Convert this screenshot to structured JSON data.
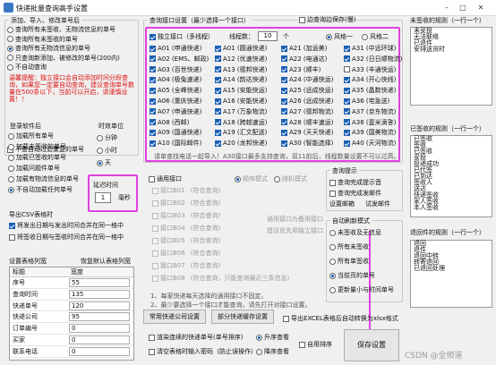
{
  "window": {
    "title": "快递批量查询高手设置"
  },
  "add": {
    "legend": "添加、导入、修改单号后",
    "options": [
      "查询所有未签收、无物流信息的单号",
      "查询所有未签收的单号",
      "查询所有无物流信息的单号",
      "只查询新添加、被修改的单号(200内)",
      "不自动查询"
    ],
    "selected": 2,
    "warning": [
      "温馨提醒：独立接口会自动添加时间分段查询，如果您一定要自动查询，建议查询单号数量在500条以下，当前可以开启，请谨慎设置！！"
    ],
    "no_dup": "不查自动过滤重复的单号"
  },
  "login": {
    "legend": "登录软件后",
    "options": [
      "加载所有单号",
      "加载未签收的单号",
      "加载已签收的单号",
      "加载问题件单号",
      "加载有物流信息的单号",
      "不自动加载任何单号"
    ],
    "selected": 5
  },
  "time_unit": {
    "legend": "时效单位",
    "options": [
      "分钟",
      "小时",
      "天"
    ],
    "selected": 2
  },
  "delay": {
    "label": "延迟时间",
    "value": "1",
    "unit": "毫秒"
  },
  "export": {
    "legend": "导出CSV表格时",
    "options": [
      "将发出日期与发出时间合并在同一格中",
      "将签收日期与签收时间合并在同一格中"
    ],
    "checked": [
      true,
      false
    ]
  },
  "columns": {
    "legend": "设置表格列宽",
    "restore": "恢复默认表格列宽",
    "headers": [
      "标题",
      "宽度"
    ],
    "rows": [
      [
        "序号",
        "55"
      ],
      [
        "查询时间",
        "135"
      ],
      [
        "快递单号",
        "120"
      ],
      [
        "快递公司",
        "95"
      ],
      [
        "订单编号",
        "0"
      ],
      [
        "买家",
        "0"
      ],
      [
        "联系电话",
        "0"
      ]
    ]
  },
  "api": {
    "legend": "查询接口设置（最少选择一个接口）",
    "edge": "边查询边保存(慢)",
    "independent": "独立接口（多线程）",
    "threads_label": "线程数：",
    "threads": "10",
    "threads_unit": "个",
    "styles": [
      "风格一",
      "风格二"
    ],
    "style_selected": 0,
    "items": [
      "A01 (申通快递)",
      "A01 (圆通快递)",
      "A21 (加运美)",
      "A31 (中远环球)",
      "A02 (EMS、邮政)",
      "A12 (优速快递)",
      "A22 (电通达)",
      "A32 (日日顺物流)",
      "A03 (百世快递)",
      "A13 (德邦快递)",
      "A23 (顺丰)",
      "A33 (丰通快运)",
      "A04 (极兔速递)",
      "A14 (韵达快递)",
      "A24 (中通快运)",
      "A34 (开心快线)",
      "A05 (全峰快递)",
      "A15 (安能快运)",
      "A25 (远成快运)",
      "A35 (晶数快递)",
      "A06 (重庆快递)",
      "A16 (安能快递)",
      "A26 (远成快递)",
      "A36 (宅急送)",
      "A07 (申通快递)",
      "A17 (万象物流)",
      "A27 (德邦物流)",
      "A37 (京东物流)",
      "A08 (西邮)",
      "A18 (跨越速运)",
      "A28 (顺丰速运)",
      "A38 (壹米滴答)",
      "A09 (国通快递)",
      "A19 (汇文配送)",
      "A29 (天天快递)",
      "A39 (国美物流)",
      "A10 (国际邮件)",
      "A20 (龙邦快递)",
      "A30 (智能选择)",
      "A40 (天河物流)"
    ],
    "note": "请单查找电话一起导入！A30接口最多支持查询，双11前后，线程数量设置不可以过高。"
  },
  "general": {
    "title": "通用接口",
    "items": [
      "接口B01",
      "接口B02",
      "接口B03",
      "接口B04",
      "接口B05",
      "接口B06",
      "接口B07",
      "接口B08"
    ],
    "placeholder": "(符合查询)",
    "last": "(符合查询，只能查询最近三条信息)",
    "modes": [
      "顺序模式",
      "随机模式"
    ],
    "tip": [
      "通用接口为备用接口",
      "建议优先用独立接口"
    ],
    "bottom": [
      "1、每家快递每天选择的通用接口不固定。",
      "2、最少要选择一个接口才能查询，请先打开对接口设置。"
    ]
  },
  "query_tip": {
    "legend": "查询提示",
    "opts": [
      "查询完成提示音",
      "查询完成发邮件"
    ],
    "email": "设置邮箱",
    "test": "试发邮件"
  },
  "refresh": {
    "legend": "自动刷新模式",
    "options": [
      "未签收及无信息",
      "所有未签收",
      "所有单签收",
      "当前页的单号",
      "更新量小与时间单号"
    ],
    "selected": 3
  },
  "common_btn": "常用快递公司设置",
  "partial": "部分快递缓存设置",
  "export_excel": "导出EXCEL表格后自动转换为xlsx格式",
  "mode1": "渲染连续的快递单号(单号排序)",
  "mode2": "清空表格时输入密码（防止误操作）",
  "order": [
    "升序查看",
    "降序查看"
  ],
  "auto_sort": "自用排序",
  "save": "保存设置",
  "watermark": "CSDN @全频道",
  "unsigned": {
    "legend": "未签收的规则（一行一个）",
    "items": [
      "未妥投",
      "无法联络",
      "已退件",
      "安排送货时"
    ]
  },
  "signed": {
    "legend": "已签收的规则（一行一个）",
    "items": [
      "已签收",
      "签收",
      "已签收",
      "妥投",
      "投递成功",
      "已代签",
      "已到达",
      "签收人",
      "送达",
      "快递签收",
      "家人签收",
      "本人签收"
    ]
  },
  "returned": {
    "legend": "退回件的规则（一行一个）",
    "items": [
      "退回",
      "退件",
      "退回中转",
      "转寄退回",
      "已退回处理"
    ]
  },
  "colors": {
    "highlight": "#e040e0",
    "accent": "#1a5fb4",
    "warning": "#dd1111"
  }
}
